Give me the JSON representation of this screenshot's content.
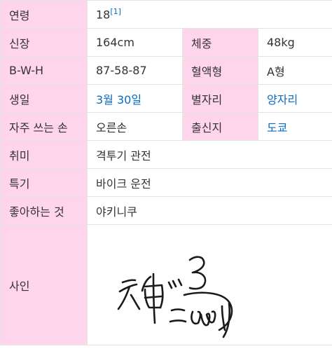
{
  "colors": {
    "key_bg": "#ffd5ec",
    "link": "#0b6bc2",
    "border": "#e2e2e2",
    "text": "#333333"
  },
  "rows": {
    "age": {
      "label": "연령",
      "value": "18",
      "ref": "[1]"
    },
    "height": {
      "label": "신장",
      "value": "164cm"
    },
    "weight": {
      "label": "체중",
      "value": "48kg"
    },
    "bwh": {
      "label": "B-W-H",
      "value": "87-58-87"
    },
    "blood": {
      "label": "혈액형",
      "value": "A형"
    },
    "birthday": {
      "label": "생일",
      "value": "3월 30일"
    },
    "zodiac": {
      "label": "별자리",
      "value": "양자리"
    },
    "hand": {
      "label": "자주 쓰는 손",
      "value": "오른손"
    },
    "origin": {
      "label": "출신지",
      "value": "도쿄"
    },
    "hobby": {
      "label": "취미",
      "value": "격투기 관전"
    },
    "skill": {
      "label": "특기",
      "value": "바이크 운전"
    },
    "likes": {
      "label": "좋아하는 것",
      "value": "야키니쿠"
    },
    "signature": {
      "label": "사인",
      "image": "handwritten-signature"
    }
  }
}
